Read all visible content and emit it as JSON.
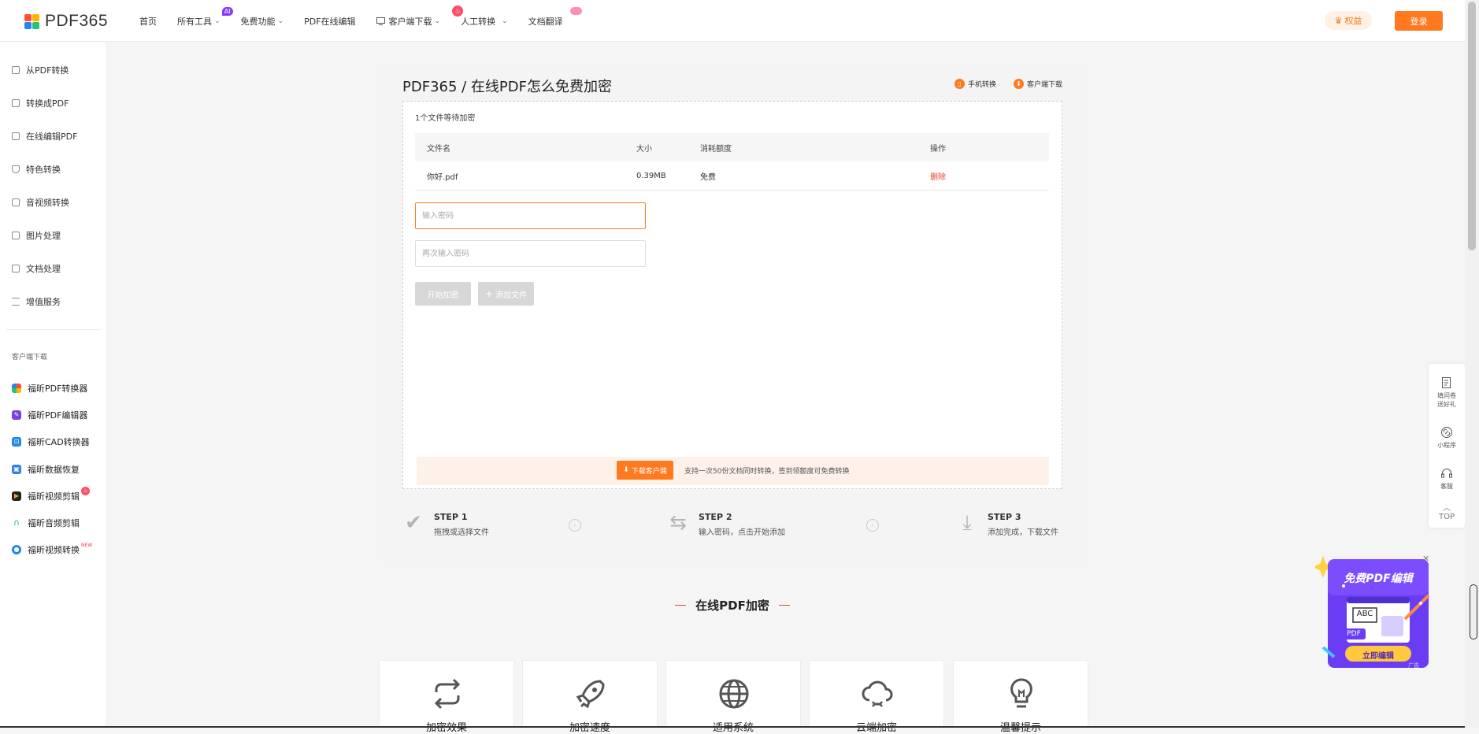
{
  "header": {
    "logo_text": "PDF365",
    "nav": [
      {
        "label": "首页"
      },
      {
        "label": "所有工具",
        "badge": "AI"
      },
      {
        "label": "免费功能"
      },
      {
        "label": "PDF在线编辑"
      },
      {
        "label": "客户端下载"
      },
      {
        "label": "人工转换"
      },
      {
        "label": "文档翻译"
      }
    ],
    "rights_label": "权益",
    "login_label": "登录"
  },
  "sidebar": {
    "items": [
      {
        "label": "从PDF转换"
      },
      {
        "label": "转换成PDF"
      },
      {
        "label": "在线编辑PDF"
      },
      {
        "label": "特色转换"
      },
      {
        "label": "音视频转换"
      },
      {
        "label": "图片处理"
      },
      {
        "label": "文档处理"
      },
      {
        "label": "增值服务"
      }
    ],
    "client_caption": "客户端下载",
    "apps": [
      {
        "label": "福昕PDF转换器",
        "color": "#f15a24"
      },
      {
        "label": "福昕PDF编辑器",
        "color": "#7b3fe4"
      },
      {
        "label": "福昕CAD转换器",
        "color": "#1e88e5"
      },
      {
        "label": "福昕数据恢复",
        "color": "#2f80ed"
      },
      {
        "label": "福昕视频剪辑",
        "color": "#f5a623"
      },
      {
        "label": "福昕音频剪辑",
        "color": "#1bbf6e"
      },
      {
        "label": "福昕视频转换",
        "color": "#1e88e5",
        "tag": "NEW"
      }
    ]
  },
  "main": {
    "title": "PDF365 / 在线PDF怎么免费加密",
    "mobile_link": "手机转换",
    "client_link": "客户端下载",
    "wait_text": "1个文件等待加密",
    "table": {
      "headers": [
        "文件名",
        "大小",
        "消耗额度",
        "操作"
      ],
      "rows": [
        {
          "name": "你好.pdf",
          "size": "0.39MB",
          "cost": "免费",
          "action": "删除"
        }
      ]
    },
    "password_placeholder": "输入密码",
    "confirm_placeholder": "再次输入密码",
    "start_label": "开始加密",
    "add_label": "添加文件",
    "download_client_label": "下载客户端",
    "promo_text": "支持一次50份文档同时转换，签到领额度可免费转换",
    "steps": [
      {
        "title": "STEP 1",
        "desc": "拖拽或选择文件"
      },
      {
        "title": "STEP 2",
        "desc": "输入密码，点击开始添加"
      },
      {
        "title": "STEP 3",
        "desc": "添加完成，下载文件"
      }
    ]
  },
  "section": {
    "title": "在线PDF加密",
    "features": [
      {
        "label": "加密效果",
        "icon": "repeat-icon"
      },
      {
        "label": "加密速度",
        "icon": "rocket-icon"
      },
      {
        "label": "适用系统",
        "icon": "globe-icon"
      },
      {
        "label": "云端加密",
        "icon": "cloud-sync-icon"
      },
      {
        "label": "温馨提示",
        "icon": "lightbulb-icon"
      }
    ]
  },
  "float_bar": {
    "survey": "填问卷送好礼",
    "mini_program": "小程序",
    "service": "客服",
    "top": "TOP"
  },
  "ad": {
    "headline": "免费PDF编辑",
    "doc_label": "ABC",
    "pdf_label": "PDF",
    "cta": "立即编辑",
    "ad_tag": "广告"
  },
  "colors": {
    "accent": "#ff7a1f",
    "danger": "#e5462f",
    "ad_purple": "#6a3df5"
  }
}
